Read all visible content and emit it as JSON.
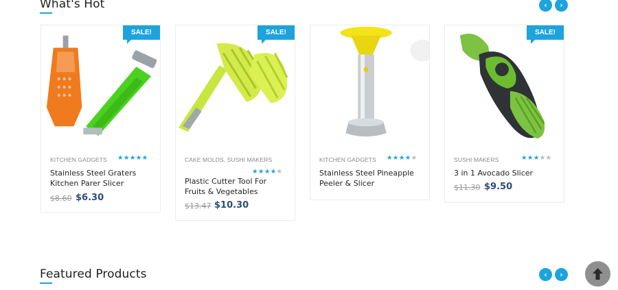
{
  "sections": {
    "whats_hot": {
      "title": "What's Hot",
      "prev_icon": "chevron-left-icon",
      "next_icon": "chevron-right-icon"
    },
    "featured": {
      "title": "Featured Products",
      "prev_icon": "chevron-left-icon",
      "next_icon": "chevron-right-icon"
    }
  },
  "glyphs": {
    "prev": "‹",
    "next": "›"
  },
  "products": [
    {
      "category": "KITCHEN GADGETS",
      "name": "Stainless Steel Graters Kitchen Parer Slicer",
      "old_price": "$8.60",
      "price": "$6.30",
      "sale_label": "SALE!",
      "rating": 5,
      "rating_max": 5,
      "image": "peeler-grater-icon"
    },
    {
      "category": "CAKE MOLDS, SUSHI MAKERS",
      "name": "Plastic Cutter Tool For Fruits & Vegetables",
      "old_price": "$13.47",
      "price": "$10.30",
      "sale_label": "SALE!",
      "rating": 4,
      "rating_max": 5,
      "image": "fruit-slicer-tongs-icon"
    },
    {
      "category": "KITCHEN GADGETS",
      "name": "Stainless Steel Pineapple Peeler & Slicer",
      "old_price": "",
      "price": "",
      "sale_label": "",
      "rating": 4,
      "rating_max": 5,
      "image": "pineapple-corer-icon"
    },
    {
      "category": "SUSHI MAKERS",
      "name": "3 in 1 Avocado Slicer",
      "old_price": "$11.30",
      "price": "$9.50",
      "sale_label": "SALE!",
      "rating": 3,
      "rating_max": 5,
      "image": "avocado-slicer-icon"
    }
  ],
  "scroll_top": {
    "icon": "arrow-up-icon"
  },
  "colors": {
    "accent": "#1ea3dc",
    "price": "#2a4e73",
    "scroll_button": "#8f8f8f"
  }
}
